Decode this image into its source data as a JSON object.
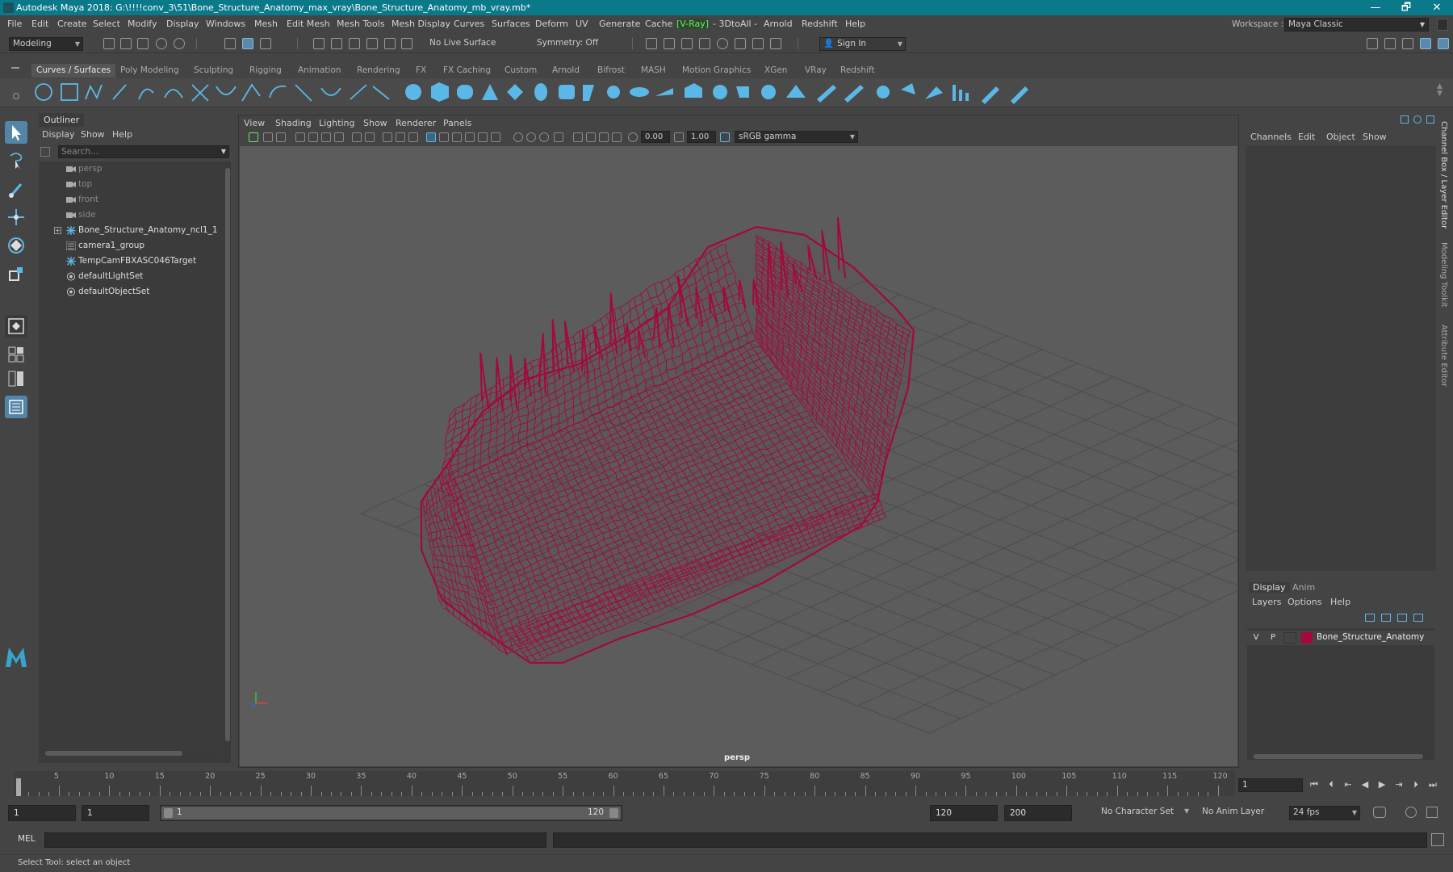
{
  "title_bar": {
    "title": "Autodesk Maya 2018: G:\\!!!!conv_3\\51\\Bone_Structure_Anatomy_max_vray\\Bone_Structure_Anatomy_mb_vray.mb*",
    "minimize": "—",
    "maximize": "🗗",
    "close": "✕"
  },
  "menu": [
    "File",
    "Edit",
    "Create",
    "Select",
    "Modify",
    "Display",
    "Windows",
    "Mesh",
    "Edit Mesh",
    "Mesh Tools",
    "Mesh Display",
    "Curves",
    "Surfaces",
    "Deform",
    "UV",
    "Generate",
    "Cache",
    "[V-Ray]",
    "- 3DtoAll -",
    "Arnold",
    "Redshift",
    "Help"
  ],
  "workspace": {
    "label": "Workspace :",
    "value": "Maya Classic"
  },
  "status_line": {
    "menu_set": "Modeling",
    "live_surface": "No Live Surface",
    "symmetry": "Symmetry: Off",
    "sign_in": "Sign In"
  },
  "shelf_tabs": [
    "Curves / Surfaces",
    "Poly Modeling",
    "Sculpting",
    "Rigging",
    "Animation",
    "Rendering",
    "FX",
    "FX Caching",
    "Custom",
    "Arnold",
    "Bifrost",
    "MASH",
    "Motion Graphics",
    "XGen",
    "VRay",
    "Redshift"
  ],
  "outliner": {
    "title": "Outliner",
    "menu": [
      "Display",
      "Show",
      "Help"
    ],
    "search_placeholder": "Search...",
    "items": [
      {
        "label": "persp",
        "icon": "camera-icon"
      },
      {
        "label": "top",
        "icon": "camera-icon"
      },
      {
        "label": "front",
        "icon": "camera-icon"
      },
      {
        "label": "side",
        "icon": "camera-icon"
      },
      {
        "label": "Bone_Structure_Anatomy_ncl1_1",
        "icon": "locator-icon"
      },
      {
        "label": "camera1_group",
        "icon": "group-icon"
      },
      {
        "label": "TempCamFBXASC046Target",
        "icon": "locator-icon"
      },
      {
        "label": "defaultLightSet",
        "icon": "set-icon"
      },
      {
        "label": "defaultObjectSet",
        "icon": "set-icon"
      }
    ]
  },
  "viewport": {
    "menu": [
      "View",
      "Shading",
      "Lighting",
      "Show",
      "Renderer",
      "Panels"
    ],
    "exposure": "0.00",
    "gamma": "1.00",
    "color_space": "sRGB gamma",
    "camera_label": "persp",
    "wire_color": "#a3093a"
  },
  "channel_box": {
    "menu": [
      "Channels",
      "Edit",
      "Object",
      "Show"
    ]
  },
  "side_tabs": [
    "Channel Box / Layer Editor",
    "Modeling Toolkit",
    "Attribute Editor"
  ],
  "layer_editor": {
    "tabs": [
      "Display",
      "Anim"
    ],
    "menu": [
      "Layers",
      "Options",
      "Help"
    ],
    "layer": {
      "v": "V",
      "p": "P",
      "name": "Bone_Structure_Anatomy",
      "color": "#a3093a"
    }
  },
  "time_slider": {
    "ticks": [
      "5",
      "10",
      "15",
      "20",
      "25",
      "30",
      "35",
      "40",
      "45",
      "50",
      "55",
      "60",
      "65",
      "70",
      "75",
      "80",
      "85",
      "90",
      "95",
      "100",
      "105",
      "110",
      "115",
      "120"
    ],
    "start_marker": "1",
    "current_frame": "1"
  },
  "range": {
    "start": "1",
    "playback_start": "1",
    "range_start_label": "1",
    "range_end_label": "120",
    "playback_end": "120",
    "end": "200",
    "character_set": "No Character Set",
    "anim_layer": "No Anim Layer",
    "fps": "24 fps"
  },
  "command_line": {
    "language": "MEL"
  },
  "help_line": {
    "text": "Select Tool: select an object"
  }
}
